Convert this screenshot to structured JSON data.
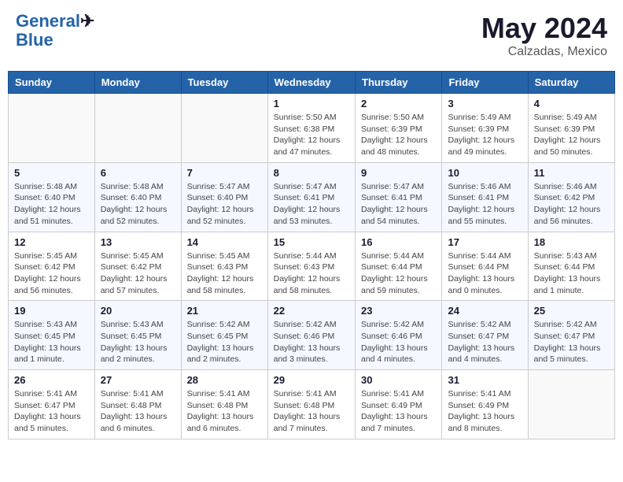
{
  "header": {
    "logo_line1": "General",
    "logo_line2": "Blue",
    "month": "May 2024",
    "location": "Calzadas, Mexico"
  },
  "weekdays": [
    "Sunday",
    "Monday",
    "Tuesday",
    "Wednesday",
    "Thursday",
    "Friday",
    "Saturday"
  ],
  "weeks": [
    [
      {
        "day": "",
        "info": ""
      },
      {
        "day": "",
        "info": ""
      },
      {
        "day": "",
        "info": ""
      },
      {
        "day": "1",
        "info": "Sunrise: 5:50 AM\nSunset: 6:38 PM\nDaylight: 12 hours\nand 47 minutes."
      },
      {
        "day": "2",
        "info": "Sunrise: 5:50 AM\nSunset: 6:39 PM\nDaylight: 12 hours\nand 48 minutes."
      },
      {
        "day": "3",
        "info": "Sunrise: 5:49 AM\nSunset: 6:39 PM\nDaylight: 12 hours\nand 49 minutes."
      },
      {
        "day": "4",
        "info": "Sunrise: 5:49 AM\nSunset: 6:39 PM\nDaylight: 12 hours\nand 50 minutes."
      }
    ],
    [
      {
        "day": "5",
        "info": "Sunrise: 5:48 AM\nSunset: 6:40 PM\nDaylight: 12 hours\nand 51 minutes."
      },
      {
        "day": "6",
        "info": "Sunrise: 5:48 AM\nSunset: 6:40 PM\nDaylight: 12 hours\nand 52 minutes."
      },
      {
        "day": "7",
        "info": "Sunrise: 5:47 AM\nSunset: 6:40 PM\nDaylight: 12 hours\nand 52 minutes."
      },
      {
        "day": "8",
        "info": "Sunrise: 5:47 AM\nSunset: 6:41 PM\nDaylight: 12 hours\nand 53 minutes."
      },
      {
        "day": "9",
        "info": "Sunrise: 5:47 AM\nSunset: 6:41 PM\nDaylight: 12 hours\nand 54 minutes."
      },
      {
        "day": "10",
        "info": "Sunrise: 5:46 AM\nSunset: 6:41 PM\nDaylight: 12 hours\nand 55 minutes."
      },
      {
        "day": "11",
        "info": "Sunrise: 5:46 AM\nSunset: 6:42 PM\nDaylight: 12 hours\nand 56 minutes."
      }
    ],
    [
      {
        "day": "12",
        "info": "Sunrise: 5:45 AM\nSunset: 6:42 PM\nDaylight: 12 hours\nand 56 minutes."
      },
      {
        "day": "13",
        "info": "Sunrise: 5:45 AM\nSunset: 6:42 PM\nDaylight: 12 hours\nand 57 minutes."
      },
      {
        "day": "14",
        "info": "Sunrise: 5:45 AM\nSunset: 6:43 PM\nDaylight: 12 hours\nand 58 minutes."
      },
      {
        "day": "15",
        "info": "Sunrise: 5:44 AM\nSunset: 6:43 PM\nDaylight: 12 hours\nand 58 minutes."
      },
      {
        "day": "16",
        "info": "Sunrise: 5:44 AM\nSunset: 6:44 PM\nDaylight: 12 hours\nand 59 minutes."
      },
      {
        "day": "17",
        "info": "Sunrise: 5:44 AM\nSunset: 6:44 PM\nDaylight: 13 hours\nand 0 minutes."
      },
      {
        "day": "18",
        "info": "Sunrise: 5:43 AM\nSunset: 6:44 PM\nDaylight: 13 hours\nand 1 minute."
      }
    ],
    [
      {
        "day": "19",
        "info": "Sunrise: 5:43 AM\nSunset: 6:45 PM\nDaylight: 13 hours\nand 1 minute."
      },
      {
        "day": "20",
        "info": "Sunrise: 5:43 AM\nSunset: 6:45 PM\nDaylight: 13 hours\nand 2 minutes."
      },
      {
        "day": "21",
        "info": "Sunrise: 5:42 AM\nSunset: 6:45 PM\nDaylight: 13 hours\nand 2 minutes."
      },
      {
        "day": "22",
        "info": "Sunrise: 5:42 AM\nSunset: 6:46 PM\nDaylight: 13 hours\nand 3 minutes."
      },
      {
        "day": "23",
        "info": "Sunrise: 5:42 AM\nSunset: 6:46 PM\nDaylight: 13 hours\nand 4 minutes."
      },
      {
        "day": "24",
        "info": "Sunrise: 5:42 AM\nSunset: 6:47 PM\nDaylight: 13 hours\nand 4 minutes."
      },
      {
        "day": "25",
        "info": "Sunrise: 5:42 AM\nSunset: 6:47 PM\nDaylight: 13 hours\nand 5 minutes."
      }
    ],
    [
      {
        "day": "26",
        "info": "Sunrise: 5:41 AM\nSunset: 6:47 PM\nDaylight: 13 hours\nand 5 minutes."
      },
      {
        "day": "27",
        "info": "Sunrise: 5:41 AM\nSunset: 6:48 PM\nDaylight: 13 hours\nand 6 minutes."
      },
      {
        "day": "28",
        "info": "Sunrise: 5:41 AM\nSunset: 6:48 PM\nDaylight: 13 hours\nand 6 minutes."
      },
      {
        "day": "29",
        "info": "Sunrise: 5:41 AM\nSunset: 6:48 PM\nDaylight: 13 hours\nand 7 minutes."
      },
      {
        "day": "30",
        "info": "Sunrise: 5:41 AM\nSunset: 6:49 PM\nDaylight: 13 hours\nand 7 minutes."
      },
      {
        "day": "31",
        "info": "Sunrise: 5:41 AM\nSunset: 6:49 PM\nDaylight: 13 hours\nand 8 minutes."
      },
      {
        "day": "",
        "info": ""
      }
    ]
  ]
}
